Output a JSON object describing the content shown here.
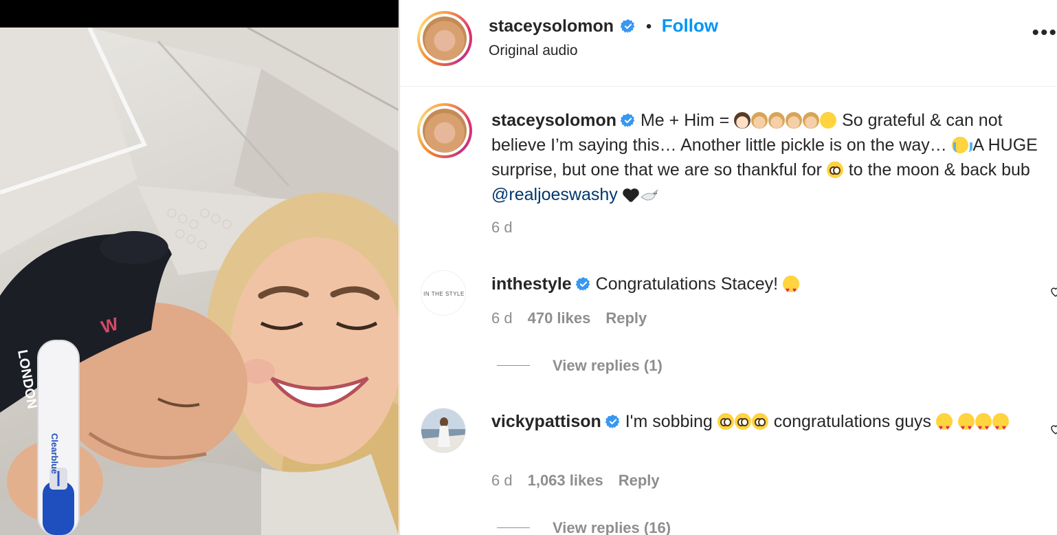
{
  "post": {
    "author": "staceysolomon",
    "separator": "•",
    "follow_label": "Follow",
    "audio_label": "Original audio",
    "more_icon": "more-horizontal-icon"
  },
  "caption": {
    "author": "staceysolomon",
    "text_part1": "Me + Him =",
    "text_part2": "So grateful & can not believe I’m saying this… Another little pickle is on the way…",
    "text_part3": "A HUGE surprise, but one that we are so thankful for",
    "text_part4": "to the moon & back bub",
    "mention": "@realjoeswashy",
    "time": "6 d"
  },
  "comments": [
    {
      "author": "inthestyle",
      "avatar_text": "IN THE STYLE",
      "text": "Congratulations Stacey!",
      "time": "6 d",
      "likes": "470 likes",
      "reply_label": "Reply",
      "view_replies": "View replies (1)"
    },
    {
      "author": "vickypattison",
      "text_part1": "I'm sobbing",
      "text_part2": "congratulations guys",
      "time": "6 d",
      "likes": "1,063 likes",
      "reply_label": "Reply",
      "view_replies": "View replies (16)"
    }
  ],
  "photo": {
    "cap_text": "LONDON",
    "test_brand": "Clearblue"
  },
  "colors": {
    "follow": "#0095f6",
    "mention": "#00376b",
    "muted": "#8e8e8e",
    "verified": "#3897f0"
  }
}
